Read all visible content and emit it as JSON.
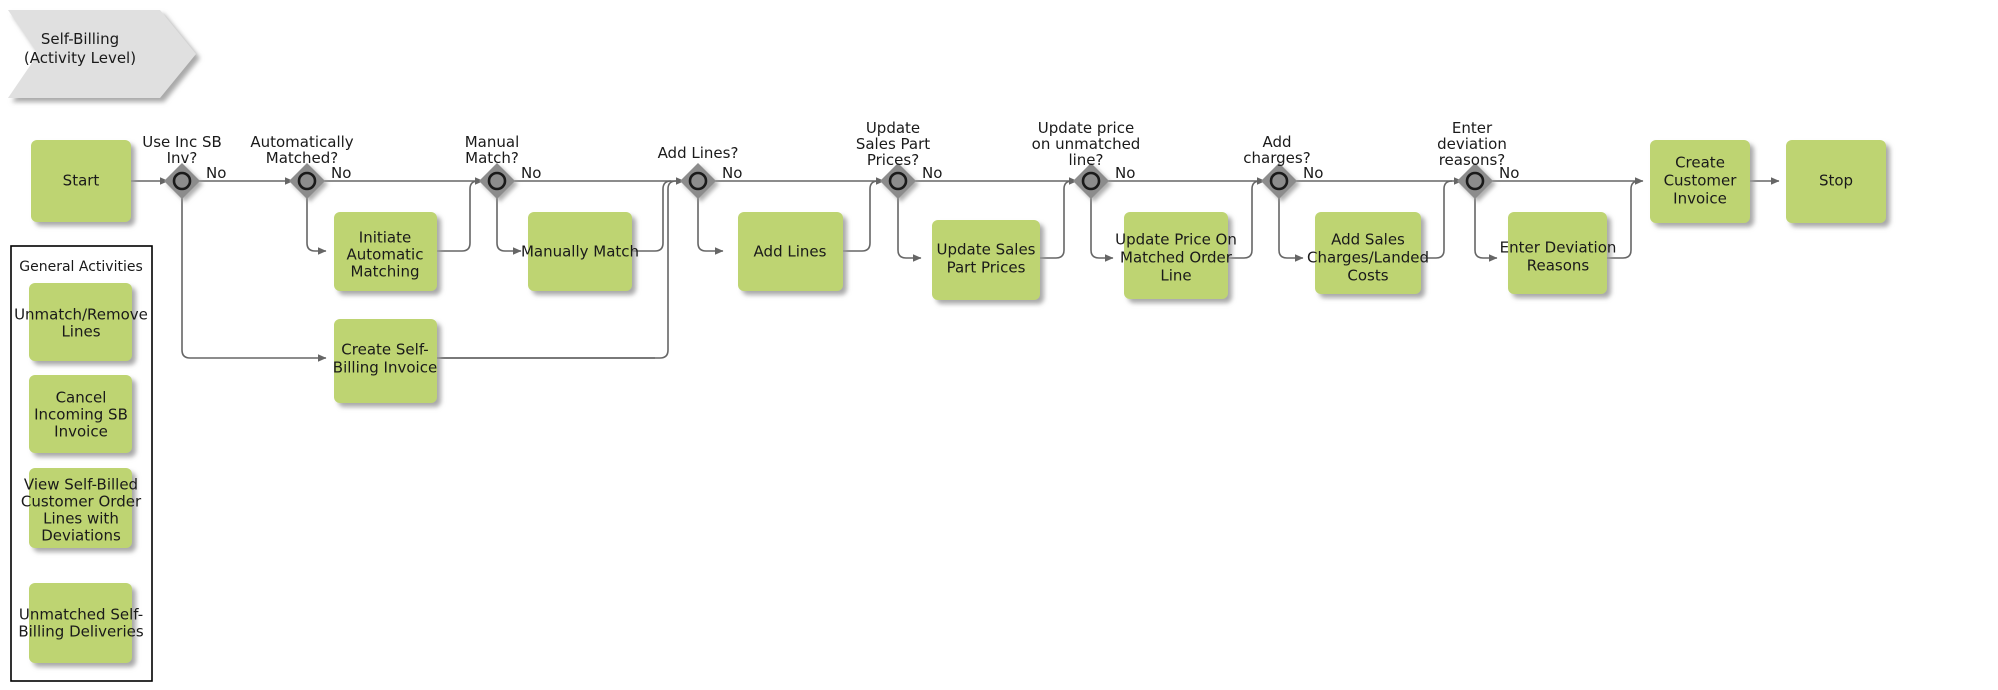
{
  "banner": {
    "line1": "Self-Billing",
    "line2": "(Activity Level)",
    "fill": "#e0e0e0"
  },
  "colors": {
    "activity_fill": "#bed472",
    "gateway_fill": "#8c8c8c",
    "connector": "#666666",
    "banner_fill": "#e0e0e0",
    "text": "#1a1a1a",
    "group_border": "#000000"
  },
  "general_activities": {
    "title": "General Activities",
    "items": [
      {
        "lines": [
          "Unmatch/Remove",
          "Lines"
        ]
      },
      {
        "lines": [
          "Cancel",
          "Incoming SB",
          "Invoice"
        ]
      },
      {
        "lines": [
          "View Self-Billed",
          "Customer Order",
          "Lines with",
          "Deviations"
        ]
      },
      {
        "lines": [
          "Unmatched Self-",
          "Billing Deliveries"
        ]
      }
    ]
  },
  "flow": {
    "start": {
      "label": "Start"
    },
    "stop": {
      "label": "Stop"
    },
    "create_customer_invoice": {
      "lines": [
        "Create",
        "Customer",
        "Invoice"
      ]
    },
    "gateways": [
      {
        "id": "use-inc-sb-inv",
        "lines": [
          "Use Inc SB",
          "Inv?"
        ],
        "edge_label": "No"
      },
      {
        "id": "automatically-matched",
        "lines": [
          "Automatically",
          "Matched?"
        ],
        "edge_label": "No"
      },
      {
        "id": "manual-match",
        "lines": [
          "Manual",
          "Match?"
        ],
        "edge_label": "No"
      },
      {
        "id": "add-lines",
        "lines": [
          "Add Lines?"
        ],
        "edge_label": "No"
      },
      {
        "id": "update-sales-part-prices",
        "lines": [
          "Update",
          "Sales Part",
          "Prices?"
        ],
        "edge_label": "No"
      },
      {
        "id": "update-price-unmatched-line",
        "lines": [
          "Update price",
          "on unmatched",
          "line?"
        ],
        "edge_label": "No"
      },
      {
        "id": "add-charges",
        "lines": [
          "Add",
          "charges?"
        ],
        "edge_label": "No"
      },
      {
        "id": "enter-deviation-reasons",
        "lines": [
          "Enter",
          "deviation",
          "reasons?"
        ],
        "edge_label": "No"
      }
    ],
    "activities": [
      {
        "id": "initiate-automatic-matching",
        "lines": [
          "Initiate",
          "Automatic",
          "Matching"
        ]
      },
      {
        "id": "create-self-billing-invoice",
        "lines": [
          "Create Self-",
          "Billing Invoice"
        ]
      },
      {
        "id": "manually-match",
        "lines": [
          "Manually Match"
        ]
      },
      {
        "id": "add-lines",
        "lines": [
          "Add Lines"
        ]
      },
      {
        "id": "update-sales-part-prices",
        "lines": [
          "Update Sales",
          "Part Prices"
        ]
      },
      {
        "id": "update-price-on-matched-order-line",
        "lines": [
          "Update Price On",
          "Matched Order",
          "Line"
        ]
      },
      {
        "id": "add-sales-charges-landed-costs",
        "lines": [
          "Add Sales",
          "Charges/Landed",
          "Costs"
        ]
      },
      {
        "id": "enter-deviation-reasons",
        "lines": [
          "Enter Deviation",
          "Reasons"
        ]
      }
    ]
  }
}
